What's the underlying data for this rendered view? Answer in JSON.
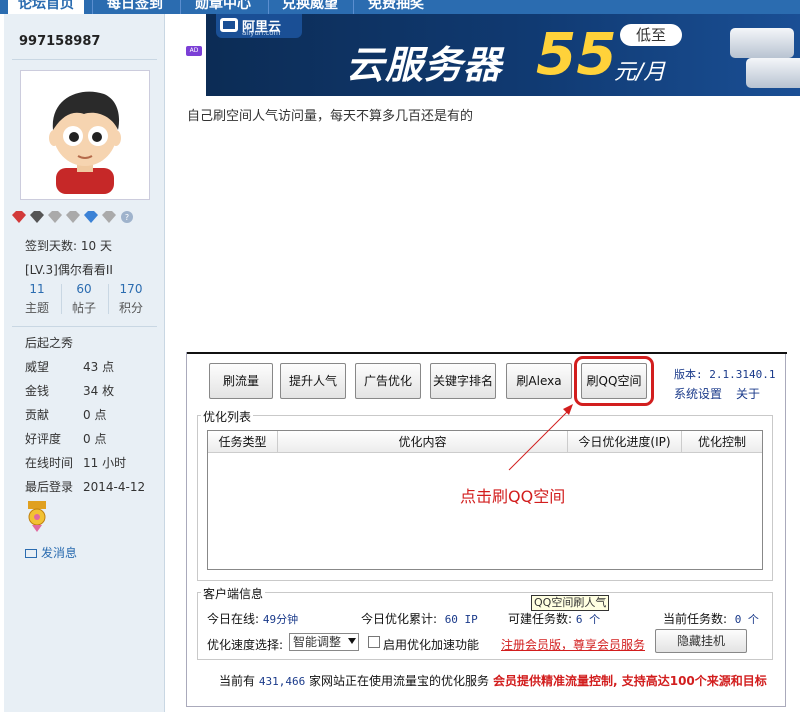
{
  "nav": {
    "tabs": [
      "论坛首页",
      "每日签到",
      "勋章中心",
      "兑换威望",
      "免费抽奖"
    ]
  },
  "sidebar": {
    "username": "997158987",
    "sign_days": "签到天数: 10 天",
    "level": "[LV.3]偶尔看看II",
    "counts": [
      {
        "num": "11",
        "label": "主题"
      },
      {
        "num": "60",
        "label": "帖子"
      },
      {
        "num": "170",
        "label": "积分"
      }
    ],
    "group": "后起之秀",
    "stats": [
      {
        "k": "威望",
        "v": "43 点"
      },
      {
        "k": "金钱",
        "v": "34 枚"
      },
      {
        "k": "贡献",
        "v": "0 点"
      },
      {
        "k": "好评度",
        "v": "0 点"
      },
      {
        "k": "在线时间",
        "v": "11 小时"
      },
      {
        "k": "最后登录",
        "v": "2014-4-12"
      }
    ],
    "message_link": "发消息"
  },
  "ad": {
    "tag": "AD",
    "logo_name": "阿里云",
    "logo_url": "aliyun.com",
    "headline": "云服务器",
    "price": "55",
    "low": "低至",
    "unit": "元/月"
  },
  "post": {
    "text": "自己刷空间人气访问量，每天不算多几百还是有的"
  },
  "app": {
    "buttons": [
      "刷流量",
      "提升人气",
      "广告优化",
      "关键字排名",
      "刷Alexa",
      "刷QQ空间"
    ],
    "version": "版本: 2.1.3140.1",
    "links": [
      "系统设置",
      "关于"
    ],
    "list_group": "优化列表",
    "columns": [
      "任务类型",
      "优化内容",
      "今日优化进度(IP)",
      "优化控制"
    ],
    "annotation": "点击刷QQ空间",
    "client_group": "客户端信息",
    "online_label": "今日在线:",
    "online_value": "49分钟",
    "total_label": "今日优化累计:",
    "total_value": "60 IP",
    "buildable_label": "可建任务数:",
    "buildable_value": "6 个",
    "current_label": "当前任务数:",
    "current_value": "0 个",
    "speed_label": "优化速度选择:",
    "speed_value": "智能调整",
    "accel_label": "启用优化加速功能",
    "register_link": "注册会员版，尊享会员服务",
    "hide_button": "隐藏挂机",
    "tooltip": "QQ空间刷人气",
    "footer_prefix": "当前有",
    "footer_count": "431,466",
    "footer_suffix": "家网站正在使用流量宝的优化服务",
    "footer_promo": "会员提供精准流量控制, 支持高达100个来源和目标"
  }
}
